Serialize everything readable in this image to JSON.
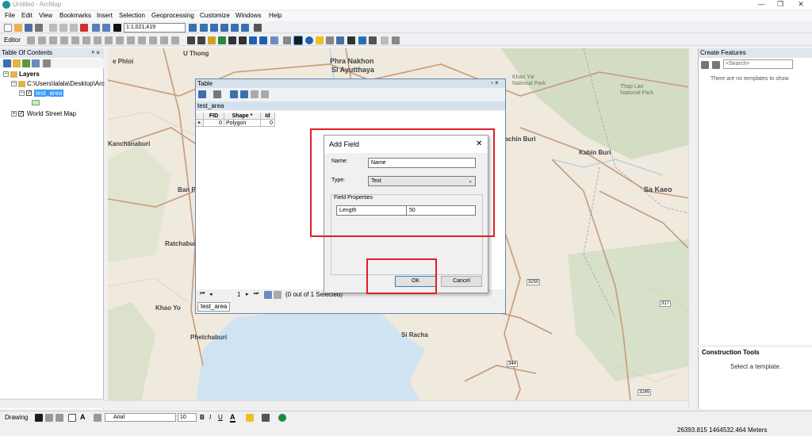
{
  "window": {
    "title": "Untitled - ArcMap",
    "controls": [
      "—",
      "❐",
      "✕"
    ]
  },
  "menu": [
    "File",
    "Edit",
    "View",
    "Bookmarks",
    "Insert",
    "Selection",
    "Geoprocessing",
    "Customize",
    "Windows",
    "Help"
  ],
  "toolbar": {
    "scale": "1:1,021,419",
    "editor_label": "Editor"
  },
  "toc": {
    "title": "Table Of Contents",
    "pin": "ᵖ ×",
    "layers_label": "Layers",
    "folder_path": "C:\\Users\\lalala\\Desktop\\Arc",
    "layer_selected": "test_area",
    "basemap": "World Street Map"
  },
  "map": {
    "labels": [
      {
        "text": "U Thong",
        "size": 8,
        "weight": "bold"
      },
      {
        "text": "Phra Nakhon",
        "size": 9,
        "weight": "bold"
      },
      {
        "text": "Si Ayutthaya",
        "size": 9,
        "weight": "bold"
      },
      {
        "text": "Kanchanaburi",
        "size": 8,
        "weight": "bold"
      },
      {
        "text": "Ban Pong",
        "size": 8,
        "weight": "bold"
      },
      {
        "text": "Ratchaburi",
        "size": 8,
        "weight": "bold"
      },
      {
        "text": "Khao Yo",
        "size": 8,
        "weight": "bold"
      },
      {
        "text": "Phetchaburi",
        "size": 8,
        "weight": "bold"
      },
      {
        "text": "Kabin Buri",
        "size": 8,
        "weight": "bold"
      },
      {
        "text": "Sa Kaeo",
        "size": 9,
        "weight": "bold"
      },
      {
        "text": "Prachin Buri",
        "size": 8,
        "weight": "bold"
      },
      {
        "text": "Si Racha",
        "size": 8,
        "weight": "bold"
      },
      {
        "text": "Khao Yai National Park",
        "size": 7,
        "weight": "normal"
      },
      {
        "text": "Thap Lan National Park",
        "size": 7,
        "weight": "normal"
      },
      {
        "text": "e Phloi",
        "size": 8,
        "weight": "bold"
      }
    ],
    "road_numbers": [
      "3250",
      "317",
      "344",
      "3245"
    ]
  },
  "table": {
    "title": "Table",
    "tab_label": "test_area",
    "columns": [
      "FID",
      "Shape *",
      "Id"
    ],
    "row": [
      "0",
      "Polygon",
      "0"
    ],
    "record": "1",
    "selection_status": "(0 out of 1 Selected)",
    "bottom_tab": "test_area"
  },
  "dialog": {
    "title": "Add Field",
    "name_label": "Name:",
    "name_value": "Name",
    "type_label": "Type:",
    "type_value": "Text",
    "properties_label": "Field Properties",
    "length_label": "Length",
    "length_value": "50",
    "ok": "OK",
    "cancel": "Cancel"
  },
  "create_features": {
    "title": "Create Features",
    "search_placeholder": "<Search>",
    "empty_message": "There are no templates to show."
  },
  "construction_tools": {
    "title": "Construction Tools",
    "message": "Select a template."
  },
  "drawing": {
    "label": "Drawing",
    "font": "Arial",
    "size": "10",
    "bold": "B",
    "italic": "I",
    "underline": "U"
  },
  "status": {
    "coords": "26393.815  1464532.464 Meters"
  },
  "colors": {
    "highlight_red": "#e01e26",
    "selection_blue": "#3399ff",
    "water": "#cfe3f2",
    "land": "#efe9de",
    "road": "#c79a7c"
  }
}
